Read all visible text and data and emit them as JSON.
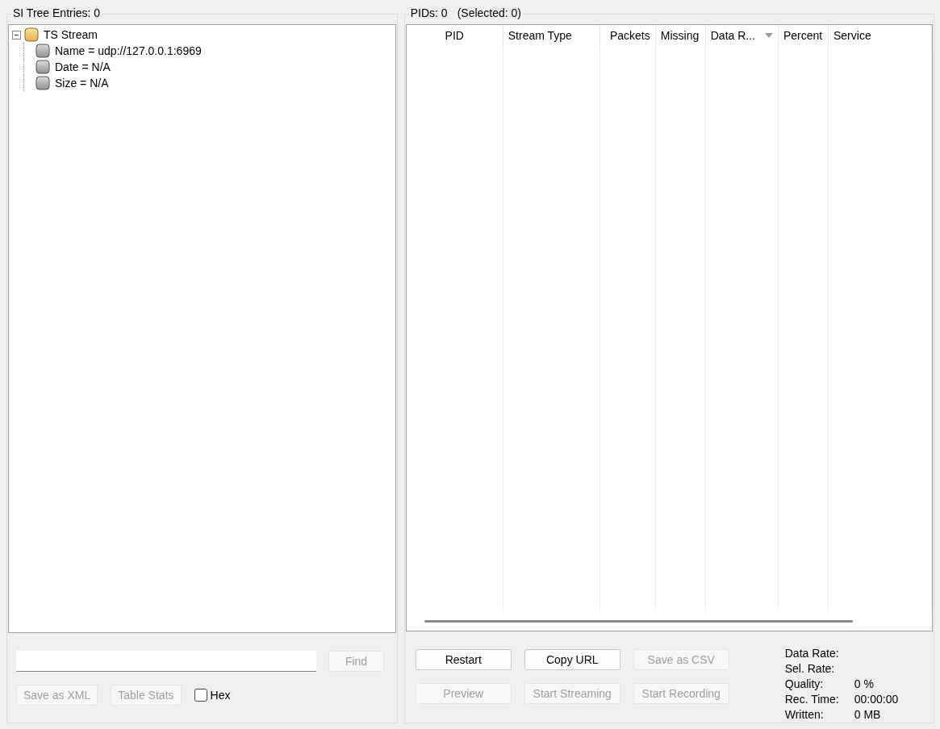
{
  "si_tree": {
    "title": "SI Tree Entries: 0",
    "nodes": [
      {
        "label": "TS Stream",
        "kind": "folder",
        "expanded": true,
        "children": [
          {
            "label": "Name = udp://127.0.0.1:6969",
            "kind": "leaf"
          },
          {
            "label": "Date = N/A",
            "kind": "leaf"
          },
          {
            "label": "Size = N/A",
            "kind": "leaf"
          }
        ]
      }
    ],
    "find_button": {
      "label": "Find",
      "disabled": true
    },
    "buttons": [
      {
        "label": "Save as XML",
        "disabled": true
      },
      {
        "label": "Table Stats",
        "disabled": true
      }
    ],
    "hex": {
      "label": "Hex",
      "checked": false
    }
  },
  "pids": {
    "title": "PIDs: 0",
    "selected_count": "(Selected: 0)",
    "columns": [
      {
        "label": "PID",
        "sorted": false
      },
      {
        "label": "Stream Type",
        "sorted": false
      },
      {
        "label": "Packets",
        "sorted": false
      },
      {
        "label": "Missing",
        "sorted": false
      },
      {
        "label": "Data R...",
        "sorted": true
      },
      {
        "label": "Percent",
        "sorted": false
      },
      {
        "label": "Service",
        "sorted": false
      }
    ],
    "buttons": [
      {
        "label": "Restart",
        "disabled": false
      },
      {
        "label": "Copy URL",
        "disabled": false
      },
      {
        "label": "Save as CSV",
        "disabled": true
      },
      {
        "label": "Preview",
        "disabled": true
      },
      {
        "label": "Start Streaming",
        "disabled": true
      },
      {
        "label": "Start Recording",
        "disabled": true
      }
    ],
    "stats": [
      {
        "label": "Data Rate:"
      },
      {
        "label": "Sel. Rate:"
      },
      {
        "label": "Quality:",
        "value": "0 %"
      },
      {
        "label": "Rec. Time:",
        "value": "00:00:00"
      },
      {
        "label": "Written:",
        "value": "0 MB"
      }
    ]
  }
}
